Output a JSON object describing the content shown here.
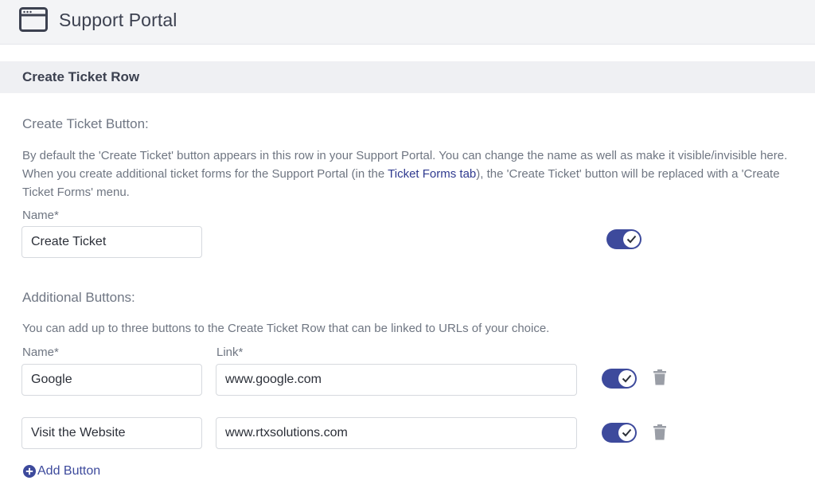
{
  "app": {
    "title": "Support Portal",
    "icon": "browser-window-icon"
  },
  "section": {
    "title": "Create Ticket Row"
  },
  "create_ticket": {
    "heading": "Create Ticket Button:",
    "description_before_link": "By default the 'Create Ticket' button appears in this row in your Support Portal. You can change the name as well as make it visible/invisible here. When you create additional ticket forms for the Support Portal (in the ",
    "description_link": "Ticket Forms tab",
    "description_after_link": "), the 'Create Ticket' button will be replaced with a 'Create Ticket Forms' menu.",
    "name_label": "Name*",
    "name_value": "Create Ticket",
    "visible": true
  },
  "additional": {
    "heading": "Additional Buttons:",
    "description": "You can add up to three buttons to the Create Ticket Row that can be linked to URLs of your choice.",
    "name_label": "Name*",
    "link_label": "Link*",
    "rows": [
      {
        "name": "Google",
        "link": "www.google.com",
        "visible": true
      },
      {
        "name": "Visit the Website",
        "link": "www.rtxsolutions.com",
        "visible": true
      }
    ],
    "add_label": "Add Button"
  },
  "colors": {
    "accent": "#3d4a9c",
    "link": "#2f3a8f",
    "trash": "#9a9ea6",
    "header_bg": "#f3f4f6",
    "section_bg": "#eff0f3"
  }
}
